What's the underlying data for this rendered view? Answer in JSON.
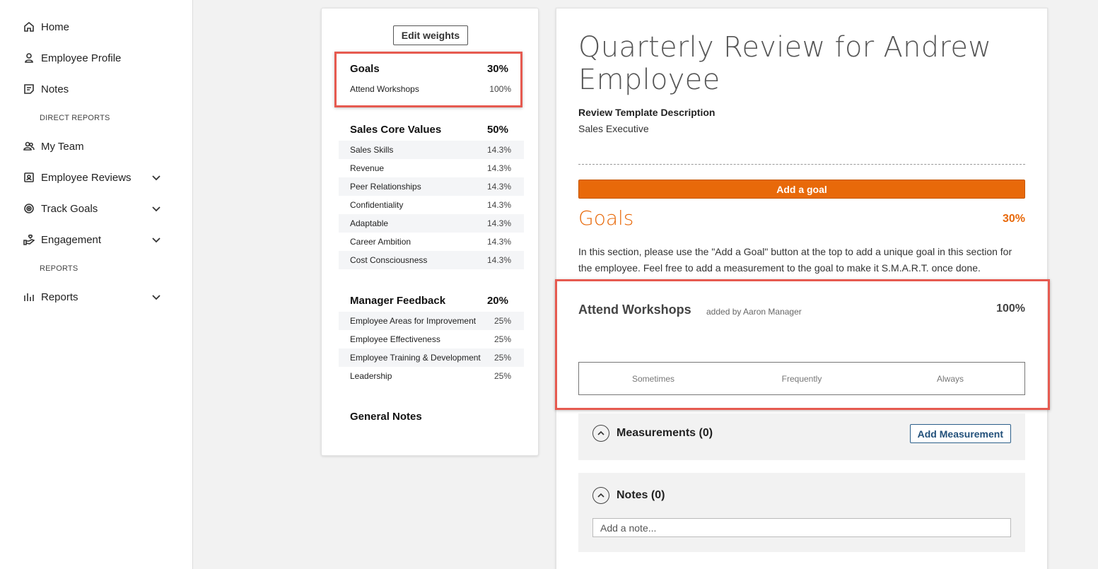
{
  "sidebar": {
    "nav": [
      {
        "label": "Home",
        "icon": "home-icon"
      },
      {
        "label": "Employee Profile",
        "icon": "user-icon"
      },
      {
        "label": "Notes",
        "icon": "notes-icon"
      }
    ],
    "direct_reports_caption": "DIRECT REPORTS",
    "team_nav": [
      {
        "label": "My Team",
        "icon": "team-icon"
      },
      {
        "label": "Employee Reviews",
        "icon": "review-icon"
      },
      {
        "label": "Track Goals",
        "icon": "target-icon"
      },
      {
        "label": "Engagement",
        "icon": "engagement-icon"
      }
    ],
    "reports_caption": "REPORTS",
    "reports_nav": {
      "label": "Reports",
      "icon": "bar-chart-icon"
    }
  },
  "weights": {
    "edit_label": "Edit weights",
    "sections": [
      {
        "title": "Goals",
        "pct": "30%",
        "items": [
          {
            "label": "Attend Workshops",
            "pct": "100%"
          }
        ]
      },
      {
        "title": "Sales Core Values",
        "pct": "50%",
        "items": [
          {
            "label": "Sales Skills",
            "pct": "14.3%"
          },
          {
            "label": "Revenue",
            "pct": "14.3%"
          },
          {
            "label": "Peer Relationships",
            "pct": "14.3%"
          },
          {
            "label": "Confidentiality",
            "pct": "14.3%"
          },
          {
            "label": "Adaptable",
            "pct": "14.3%"
          },
          {
            "label": "Career Ambition",
            "pct": "14.3%"
          },
          {
            "label": "Cost Consciousness",
            "pct": "14.3%"
          }
        ]
      },
      {
        "title": "Manager Feedback",
        "pct": "20%",
        "items": [
          {
            "label": "Employee Areas for Improvement",
            "pct": "25%"
          },
          {
            "label": "Employee Effectiveness",
            "pct": "25%"
          },
          {
            "label": "Employee Training & Development",
            "pct": "25%"
          },
          {
            "label": "Leadership",
            "pct": "25%"
          }
        ]
      },
      {
        "title": "General Notes",
        "pct": "",
        "items": []
      }
    ]
  },
  "review": {
    "title": "Quarterly Review for Andrew Employee",
    "template_label": "Review Template Description",
    "template_value": "Sales Executive",
    "add_goal_label": "Add a goal",
    "goals_heading": "Goals",
    "goals_pct": "30%",
    "goals_description": "In this section, please use the \"Add a Goal\" button at the top to add a unique goal in this section for the employee.  Feel free to add a measurement to the goal to make it S.M.A.R.T. once done.",
    "goal": {
      "title": "Attend Workshops",
      "added_by": "added by Aaron Manager",
      "pct": "100%",
      "scale": [
        "Sometimes",
        "Frequently",
        "Always"
      ]
    },
    "measurements_label": "Measurements (0)",
    "add_measurement_label": "Add Measurement",
    "notes_label": "Notes (0)",
    "note_placeholder": "Add a note..."
  },
  "colors": {
    "accent": "#e8690a",
    "highlight": "#e65a50",
    "link": "#22507a"
  }
}
